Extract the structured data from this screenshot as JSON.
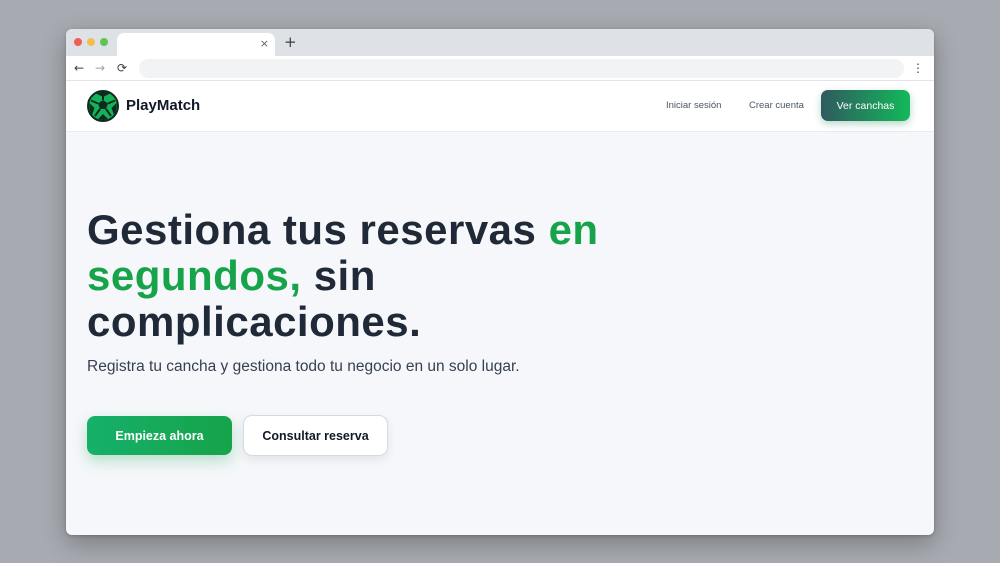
{
  "browser": {
    "tab_close": "×",
    "new_tab": "+",
    "back_icon": "←",
    "forward_icon": "→",
    "reload_icon": "⟳",
    "menu_icon": "⋮",
    "address": ""
  },
  "header": {
    "brand": "PlayMatch",
    "logo_icon": "soccer-ball-icon",
    "nav": {
      "login": "Iniciar sesión",
      "signup": "Crear cuenta",
      "cta": "Ver canchas"
    }
  },
  "hero": {
    "title_part1": "Gestiona tus reservas ",
    "title_accent": "en segundos,",
    "title_part2": " sin complicaciones.",
    "subtitle": "Registra tu cancha y gestiona todo tu negocio en un solo lugar.",
    "primary_button": "Empieza ahora",
    "secondary_button": "Consultar reserva"
  },
  "colors": {
    "accent": "#16a34a",
    "text_dark": "#1f2937",
    "cta_gradient_start": "#2f5a5f",
    "cta_gradient_end": "#13b95a"
  }
}
